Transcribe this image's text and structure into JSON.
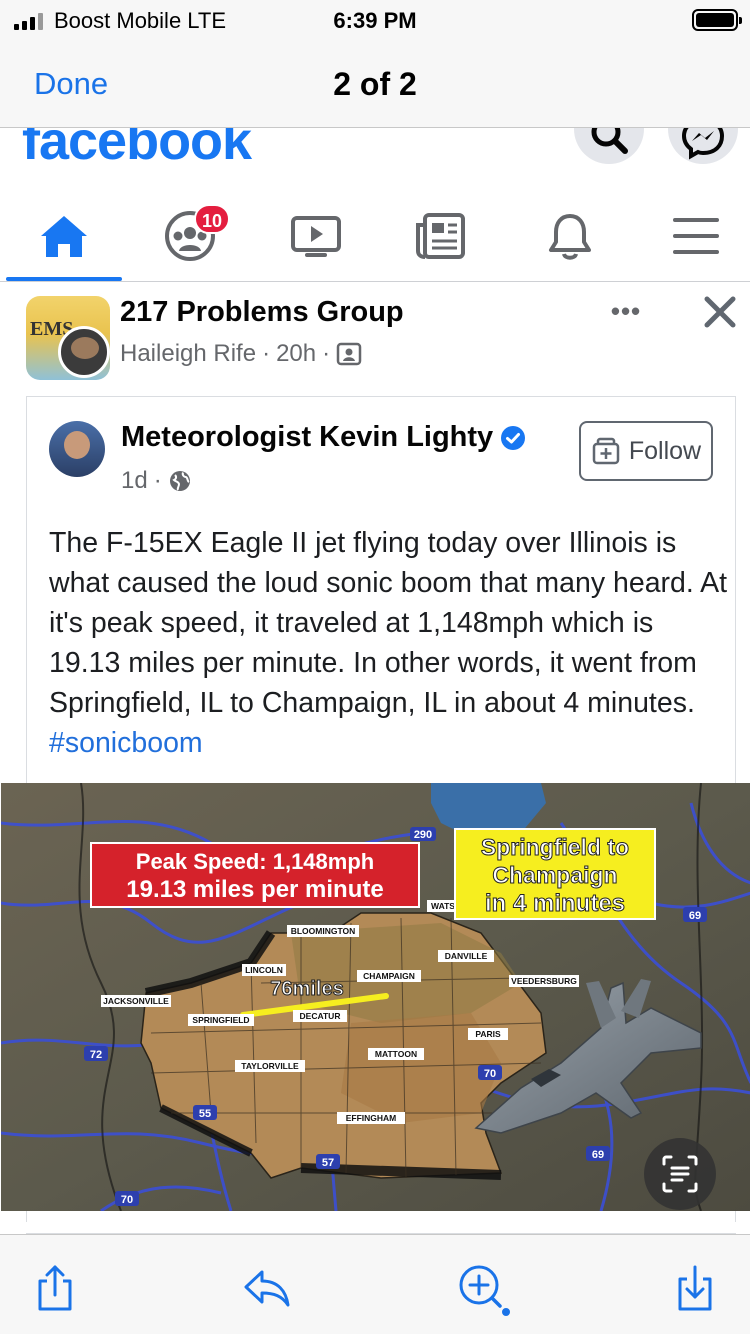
{
  "status_bar": {
    "carrier": "Boost Mobile  LTE",
    "time": "6:39 PM"
  },
  "viewer_nav": {
    "done_label": "Done",
    "page_indicator": "2 of 2"
  },
  "facebook": {
    "logo_text": "facebook",
    "nav": {
      "groups_badge": "10"
    },
    "post": {
      "group_name": "217 Problems Group",
      "author": "Haileigh Rife",
      "time": "20h",
      "more_label": "•••",
      "shared": {
        "author_name": "Meteorologist Kevin Lighty",
        "time": "1d",
        "follow_label": "Follow",
        "text": "The F-15EX Eagle II jet flying today over Illinois is what caused the loud sonic boom that many heard. At it's peak speed, it traveled at 1,148mph which is 19.13 miles per minute. In other words, it went from Springfield, IL to Champaign, IL in about 4 minutes.",
        "hashtag": "#sonicboom"
      }
    },
    "map_graphic": {
      "peak_line1": "Peak Speed: 1,148mph",
      "peak_line2": "19.13 miles per minute",
      "route_line1": "Springfield to",
      "route_line2": "Champaign",
      "route_line3": "in 4 minutes",
      "distance": "76miles",
      "cities": {
        "bloomington": "BLOOMINGTON",
        "lincoln": "LINCOLN",
        "champaign": "CHAMPAIGN",
        "danville": "DANVILLE",
        "veedersburg": "VEEDERSBURG",
        "jacksonville": "JACKSONVILLE",
        "springfield": "SPRINGFIELD",
        "decatur": "DECATUR",
        "paris": "PARIS",
        "mattoon": "MATTOON",
        "taylorville": "TAYLORVILLE",
        "effingham": "EFFINGHAM",
        "wats": "WATS"
      },
      "highways": {
        "h290": "290",
        "h69a": "69",
        "h72": "72",
        "h70a": "70",
        "h55": "55",
        "h57": "57",
        "h69b": "69",
        "h70b": "70"
      }
    }
  },
  "colors": {
    "facebook_blue": "#1877f2",
    "ios_blue": "#1a73e8",
    "badge_red": "#e41e3f",
    "map_red": "#d5222b",
    "map_yellow": "#f6ee1f"
  }
}
